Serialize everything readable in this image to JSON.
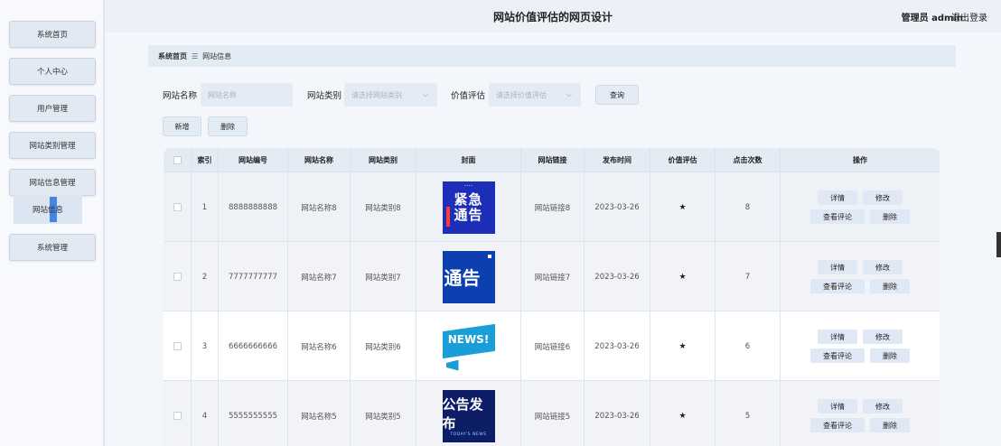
{
  "header": {
    "title": "网站价值评估的网页设计",
    "user": "管理员 admin",
    "logout": "退出登录"
  },
  "sidebar": {
    "items": [
      {
        "label": "系统首页"
      },
      {
        "label": "个人中心"
      },
      {
        "label": "用户管理"
      },
      {
        "label": "网站类别管理"
      },
      {
        "label": "网站信息管理"
      },
      {
        "label": "系统管理"
      }
    ],
    "active_sub": "网站信息"
  },
  "breadcrumb": {
    "home": "系统首页",
    "sep": "☰",
    "current": "网站信息"
  },
  "search": {
    "name_label": "网站名称",
    "name_placeholder": "网站名称",
    "category_label": "网站类别",
    "category_placeholder": "请选择网站类别",
    "rating_label": "价值评估",
    "rating_placeholder": "请选择价值评估",
    "query_button": "查询"
  },
  "actions": {
    "add": "新增",
    "delete": "删除"
  },
  "table": {
    "columns": [
      "索引",
      "网站编号",
      "网站名称",
      "网站类别",
      "封面",
      "网站链接",
      "发布时间",
      "价值评估",
      "点击次数",
      "操作"
    ],
    "rows": [
      {
        "index": "1",
        "code": "8888888888",
        "name": "网站名称8",
        "category": "网站类别8",
        "cover": "紧急通告",
        "link": "网站链接8",
        "date": "2023-03-26",
        "rating": "★",
        "clicks": "8"
      },
      {
        "index": "2",
        "code": "7777777777",
        "name": "网站名称7",
        "category": "网站类别7",
        "cover": "通告",
        "link": "网站链接7",
        "date": "2023-03-26",
        "rating": "★",
        "clicks": "7"
      },
      {
        "index": "3",
        "code": "6666666666",
        "name": "网站名称6",
        "category": "网站类别6",
        "cover": "NEWS!",
        "link": "网站链接6",
        "date": "2023-03-26",
        "rating": "★",
        "clicks": "6"
      },
      {
        "index": "4",
        "code": "5555555555",
        "name": "网站名称5",
        "category": "网站类别5",
        "cover": "公告发布",
        "link": "网站链接5",
        "date": "2023-03-26",
        "rating": "★",
        "clicks": "5"
      }
    ],
    "row_actions": {
      "detail": "详情",
      "edit": "修改",
      "comments": "查看评论",
      "delete": "删除"
    }
  },
  "colors": {
    "accent": "#2a73d9",
    "panel": "#e3ebf5"
  }
}
